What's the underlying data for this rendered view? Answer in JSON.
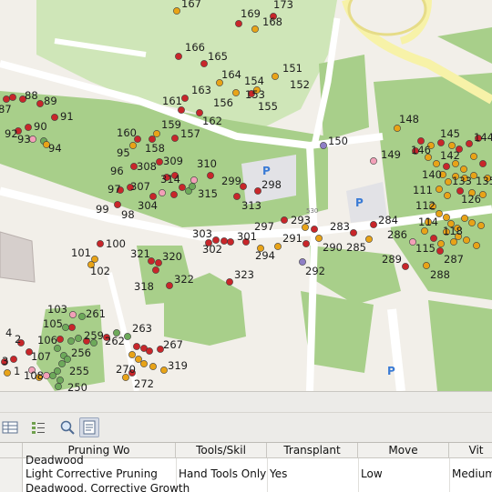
{
  "map": {
    "parking_label": "P",
    "road_label": "530",
    "colors": {
      "red": "#c8262a",
      "orange": "#e8a317",
      "green": "#6da95a",
      "pink": "#f2a0b8",
      "purple": "#8f7fc6",
      "park": "#a8cf8a",
      "grass": "#cfe6b8",
      "building": "#d6cfcc",
      "road_yellow": "#f7f2a8"
    },
    "labels": [
      {
        "id": "l167",
        "text": "167"
      },
      {
        "id": "l169",
        "text": "169"
      },
      {
        "id": "l168",
        "text": "168"
      },
      {
        "id": "l173",
        "text": "173"
      },
      {
        "id": "l166",
        "text": "166"
      },
      {
        "id": "l165",
        "text": "165"
      },
      {
        "id": "l151",
        "text": "151"
      },
      {
        "id": "l164",
        "text": "164"
      },
      {
        "id": "l154",
        "text": "154"
      },
      {
        "id": "l152",
        "text": "152"
      },
      {
        "id": "l163",
        "text": "163"
      },
      {
        "id": "l161",
        "text": "161"
      },
      {
        "id": "l156",
        "text": "156"
      },
      {
        "id": "l153",
        "text": "153"
      },
      {
        "id": "l155",
        "text": "155"
      },
      {
        "id": "l162",
        "text": "162"
      },
      {
        "id": "l88",
        "text": "88"
      },
      {
        "id": "l87",
        "text": "87"
      },
      {
        "id": "l89",
        "text": "89"
      },
      {
        "id": "l91",
        "text": "91"
      },
      {
        "id": "l90",
        "text": "90"
      },
      {
        "id": "l92",
        "text": "92"
      },
      {
        "id": "l93",
        "text": "93"
      },
      {
        "id": "l94",
        "text": "94"
      },
      {
        "id": "l159",
        "text": "159"
      },
      {
        "id": "l157",
        "text": "157"
      },
      {
        "id": "l160",
        "text": "160"
      },
      {
        "id": "l158",
        "text": "158"
      },
      {
        "id": "l150",
        "text": "150"
      },
      {
        "id": "l148",
        "text": "148"
      },
      {
        "id": "l145",
        "text": "145"
      },
      {
        "id": "l144",
        "text": "144"
      },
      {
        "id": "l146",
        "text": "146"
      },
      {
        "id": "l149",
        "text": "149"
      },
      {
        "id": "l142",
        "text": "142"
      },
      {
        "id": "l95",
        "text": "95"
      },
      {
        "id": "l309",
        "text": "309"
      },
      {
        "id": "l310",
        "text": "310"
      },
      {
        "id": "l308",
        "text": "308"
      },
      {
        "id": "l96",
        "text": "96"
      },
      {
        "id": "l314",
        "text": "314"
      },
      {
        "id": "l299",
        "text": "299"
      },
      {
        "id": "l298",
        "text": "298"
      },
      {
        "id": "l140",
        "text": "140"
      },
      {
        "id": "l133",
        "text": "133"
      },
      {
        "id": "l135",
        "text": "135"
      },
      {
        "id": "l97",
        "text": "97"
      },
      {
        "id": "l307",
        "text": "307"
      },
      {
        "id": "l315",
        "text": "315"
      },
      {
        "id": "l111",
        "text": "111"
      },
      {
        "id": "l126",
        "text": "126"
      },
      {
        "id": "l304",
        "text": "304"
      },
      {
        "id": "l313",
        "text": "313"
      },
      {
        "id": "l99",
        "text": "99"
      },
      {
        "id": "l98",
        "text": "98"
      },
      {
        "id": "l112",
        "text": "112"
      },
      {
        "id": "l293",
        "text": "293"
      },
      {
        "id": "l284",
        "text": "284"
      },
      {
        "id": "l114",
        "text": "114"
      },
      {
        "id": "l297",
        "text": "297"
      },
      {
        "id": "l283",
        "text": "283"
      },
      {
        "id": "l118",
        "text": "118"
      },
      {
        "id": "l303",
        "text": "303"
      },
      {
        "id": "l286",
        "text": "286"
      },
      {
        "id": "l301",
        "text": "301"
      },
      {
        "id": "l291",
        "text": "291"
      },
      {
        "id": "l302",
        "text": "302"
      },
      {
        "id": "l100",
        "text": "100"
      },
      {
        "id": "l290",
        "text": "290"
      },
      {
        "id": "l285",
        "text": "285"
      },
      {
        "id": "l115",
        "text": "115"
      },
      {
        "id": "l321",
        "text": "321"
      },
      {
        "id": "l294",
        "text": "294"
      },
      {
        "id": "l101",
        "text": "101"
      },
      {
        "id": "l320",
        "text": "320"
      },
      {
        "id": "l289",
        "text": "289"
      },
      {
        "id": "l287",
        "text": "287"
      },
      {
        "id": "l292",
        "text": "292"
      },
      {
        "id": "l102",
        "text": "102"
      },
      {
        "id": "l288",
        "text": "288"
      },
      {
        "id": "l323",
        "text": "323"
      },
      {
        "id": "l322",
        "text": "322"
      },
      {
        "id": "l318",
        "text": "318"
      },
      {
        "id": "l103",
        "text": "103"
      },
      {
        "id": "l261",
        "text": "261"
      },
      {
        "id": "l105",
        "text": "105"
      },
      {
        "id": "l263",
        "text": "263"
      },
      {
        "id": "l4",
        "text": "4"
      },
      {
        "id": "l2",
        "text": "2"
      },
      {
        "id": "l259",
        "text": "259"
      },
      {
        "id": "l262",
        "text": "262"
      },
      {
        "id": "l106",
        "text": "106"
      },
      {
        "id": "l267",
        "text": "267"
      },
      {
        "id": "l256",
        "text": "256"
      },
      {
        "id": "l3",
        "text": "3"
      },
      {
        "id": "l107",
        "text": "107"
      },
      {
        "id": "l319",
        "text": "319"
      },
      {
        "id": "l270",
        "text": "270"
      },
      {
        "id": "l1",
        "text": "1"
      },
      {
        "id": "l255",
        "text": "255"
      },
      {
        "id": "l108",
        "text": "108"
      },
      {
        "id": "l272",
        "text": "272"
      },
      {
        "id": "l250",
        "text": "250"
      }
    ]
  },
  "toolbar": {
    "icons": [
      "table-icon",
      "field-list-icon",
      "zoom-map-icon",
      "form-view-icon"
    ]
  },
  "table": {
    "columns": [
      "Pruning Wo",
      "Tools/Skil",
      "Transplant",
      "Move",
      "Vit"
    ],
    "prev_partial": "Deadwood",
    "row": {
      "pruning": "Light Corrective Pruning",
      "tools": "Hand Tools Only",
      "transplant": "Yes",
      "move": "Low",
      "vit": "Medium"
    },
    "next_partial": "Deadwood, Corrective Growth"
  }
}
